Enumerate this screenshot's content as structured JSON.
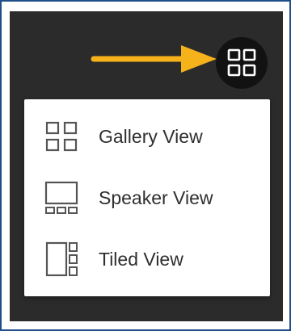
{
  "layout_button": {
    "icon": "grid-view-icon",
    "icon_color": "#ffffff",
    "background": "#121212"
  },
  "annotation": {
    "icon": "arrow-right-icon",
    "color": "#f5b21a"
  },
  "menu": {
    "items": [
      {
        "label": "Gallery View",
        "icon": "gallery-view-icon"
      },
      {
        "label": "Speaker View",
        "icon": "speaker-view-icon"
      },
      {
        "label": "Tiled View",
        "icon": "tiled-view-icon"
      }
    ]
  },
  "colors": {
    "backdrop": "#2b2b2b",
    "frame_border": "#1f4f8a",
    "menu_text": "#2f2f2f",
    "icon_stroke": "#555555"
  }
}
